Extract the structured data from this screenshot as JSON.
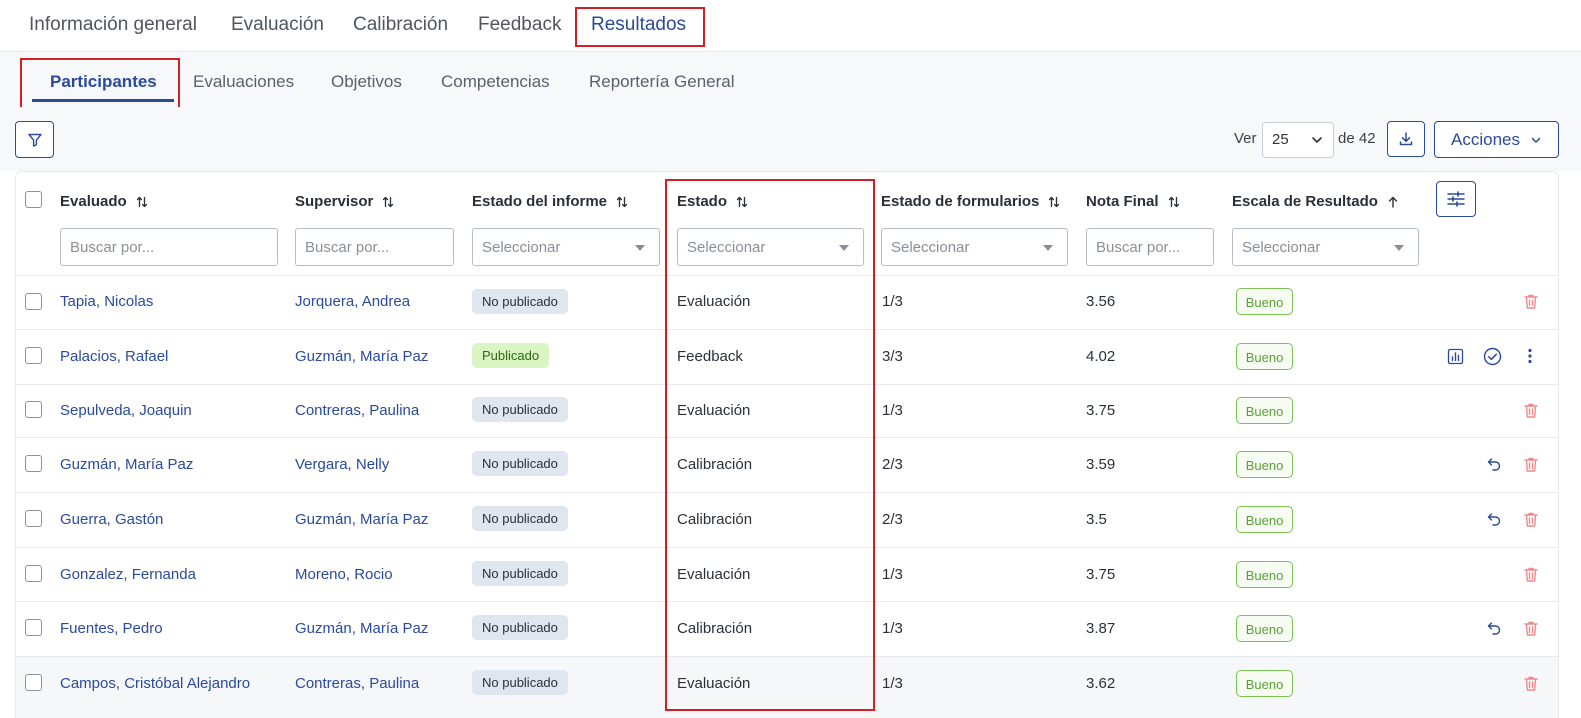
{
  "top_tabs": [
    {
      "label": "Información general"
    },
    {
      "label": "Evaluación"
    },
    {
      "label": "Calibración"
    },
    {
      "label": "Feedback"
    },
    {
      "label": "Resultados",
      "active": true
    }
  ],
  "sub_tabs": [
    {
      "label": "Participantes",
      "active": true
    },
    {
      "label": "Evaluaciones"
    },
    {
      "label": "Objetivos"
    },
    {
      "label": "Competencias"
    },
    {
      "label": "Reportería General"
    }
  ],
  "toolbar": {
    "filter_icon": "filter-icon",
    "ver_label": "Ver",
    "page_size": "25",
    "de_label": "de 42",
    "download_icon": "download-icon",
    "actions_label": "Acciones"
  },
  "columns": {
    "evaluado": "Evaluado",
    "supervisor": "Supervisor",
    "estado_informe": "Estado del informe",
    "estado": "Estado",
    "estado_formularios": "Estado de formularios",
    "nota_final": "Nota Final",
    "escala": "Escala de Resultado"
  },
  "filters": {
    "evaluado": "Buscar por...",
    "supervisor": "Buscar por...",
    "estado_informe": "Seleccionar",
    "estado": "Seleccionar",
    "estado_formularios": "Seleccionar",
    "nota_final": "Buscar por...",
    "escala": "Seleccionar"
  },
  "rows": [
    {
      "evaluado": "Tapia, Nicolas",
      "supervisor": "Jorquera, Andrea",
      "informe": "No publicado",
      "estado": "Evaluación",
      "formularios": "1/3",
      "nota": "3.56",
      "escala": "Bueno",
      "actions": [
        "trash"
      ]
    },
    {
      "evaluado": "Palacios, Rafael",
      "supervisor": "Guzmán, María Paz",
      "informe": "Publicado",
      "estado": "Feedback",
      "formularios": "3/3",
      "nota": "4.02",
      "escala": "Bueno",
      "actions": [
        "chart",
        "check",
        "more"
      ]
    },
    {
      "evaluado": "Sepulveda, Joaquin",
      "supervisor": "Contreras, Paulina",
      "informe": "No publicado",
      "estado": "Evaluación",
      "formularios": "1/3",
      "nota": "3.75",
      "escala": "Bueno",
      "actions": [
        "trash"
      ]
    },
    {
      "evaluado": "Guzmán, María Paz",
      "supervisor": "Vergara, Nelly",
      "informe": "No publicado",
      "estado": "Calibración",
      "formularios": "2/3",
      "nota": "3.59",
      "escala": "Bueno",
      "actions": [
        "undo",
        "trash"
      ]
    },
    {
      "evaluado": "Guerra, Gastón",
      "supervisor": "Guzmán, María Paz",
      "informe": "No publicado",
      "estado": "Calibración",
      "formularios": "2/3",
      "nota": "3.5",
      "escala": "Bueno",
      "actions": [
        "undo",
        "trash"
      ]
    },
    {
      "evaluado": "Gonzalez, Fernanda",
      "supervisor": "Moreno, Rocio",
      "informe": "No publicado",
      "estado": "Evaluación",
      "formularios": "1/3",
      "nota": "3.75",
      "escala": "Bueno",
      "actions": [
        "trash"
      ]
    },
    {
      "evaluado": "Fuentes, Pedro",
      "supervisor": "Guzmán, María Paz",
      "informe": "No publicado",
      "estado": "Calibración",
      "formularios": "1/3",
      "nota": "3.87",
      "escala": "Bueno",
      "actions": [
        "undo",
        "trash"
      ]
    },
    {
      "evaluado": "Campos, Cristóbal Alejandro",
      "supervisor": "Contreras, Paulina",
      "informe": "No publicado",
      "estado": "Evaluación",
      "formularios": "1/3",
      "nota": "3.62",
      "escala": "Bueno",
      "actions": [
        "trash"
      ]
    }
  ],
  "colors": {
    "primary": "#2a4a9b",
    "highlight": "#d51f26",
    "danger_icon": "#f08a8a",
    "success": "#7cc255"
  }
}
